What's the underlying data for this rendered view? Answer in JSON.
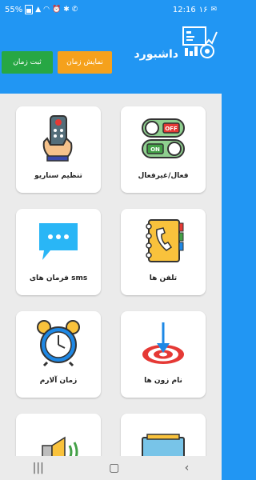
{
  "status": {
    "time": "12:16",
    "notif_count": "۱۶",
    "battery": "55%"
  },
  "header": {
    "title": "داشبورد",
    "save_time_label": "ثبت زمان",
    "show_time_label": "نمایش زمان",
    "menu_label": "......"
  },
  "cards": [
    {
      "label": "فعال/غیرفعال",
      "icon": "toggle-switch-icon"
    },
    {
      "label": "تنظیم سناریو",
      "icon": "remote-control-icon"
    },
    {
      "label": "تلفن ها",
      "icon": "phone-book-icon"
    },
    {
      "label": "فرمان های sms",
      "icon": "sms-chat-icon"
    },
    {
      "label": "نام زون ها",
      "icon": "target-zone-icon"
    },
    {
      "label": "زمان آلارم",
      "icon": "alarm-clock-icon"
    },
    {
      "label": "",
      "icon": "display-screen-icon"
    },
    {
      "label": "",
      "icon": "siren-speaker-icon"
    }
  ],
  "colors": {
    "header_bg": "#2196f3",
    "save_button": "#27a744",
    "show_button": "#f5a11c",
    "content_bg": "#ebebeb"
  }
}
